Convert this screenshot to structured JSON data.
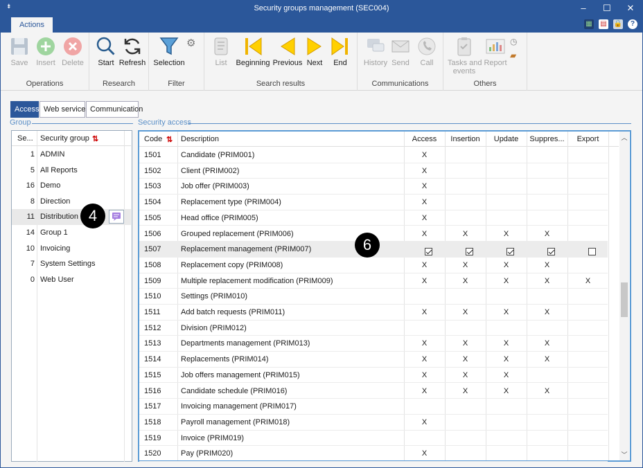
{
  "window": {
    "title": "Security groups management (SEC004)",
    "min": "–",
    "max": "☐",
    "close": "✕",
    "sysmenu": "⇟"
  },
  "ribbon": {
    "tab": "Actions",
    "groups": {
      "operations": "Operations",
      "research": "Research",
      "filter": "Filter",
      "search_results": "Search results",
      "communications": "Communications",
      "others": "Others"
    },
    "buttons": {
      "save": "Save",
      "insert": "Insert",
      "delete": "Delete",
      "start": "Start",
      "refresh": "Refresh",
      "selection": "Selection",
      "list": "List",
      "beginning": "Beginning",
      "previous": "Previous",
      "next": "Next",
      "end": "End",
      "history": "History",
      "send": "Send",
      "call": "Call",
      "tasks_l1": "Tasks and",
      "tasks_l2": "events",
      "report": "Report"
    }
  },
  "subtabs": [
    "Access",
    "Web services",
    "Communication"
  ],
  "section": {
    "group": "Group",
    "security_access": "Security access"
  },
  "group_table": {
    "headers": [
      "Se...",
      "Security group"
    ],
    "rows": [
      [
        "1",
        "ADMIN"
      ],
      [
        "5",
        "All Reports"
      ],
      [
        "16",
        "Demo"
      ],
      [
        "8",
        "Direction"
      ],
      [
        "11",
        "Distribution"
      ],
      [
        "14",
        "Group 1"
      ],
      [
        "10",
        "Invoicing"
      ],
      [
        "7",
        "System Settings"
      ],
      [
        "0",
        "Web User"
      ]
    ]
  },
  "access_table": {
    "headers": [
      "Code",
      "Description",
      "Access",
      "Insertion",
      "Update",
      "Suppres...",
      "Export"
    ],
    "rows": [
      {
        "code": "1501",
        "desc": "Candidate (PRIM001)",
        "a": "X",
        "i": "",
        "u": "",
        "s": "",
        "e": ""
      },
      {
        "code": "1502",
        "desc": "Client (PRIM002)",
        "a": "X",
        "i": "",
        "u": "",
        "s": "",
        "e": ""
      },
      {
        "code": "1503",
        "desc": "Job offer (PRIM003)",
        "a": "X",
        "i": "",
        "u": "",
        "s": "",
        "e": ""
      },
      {
        "code": "1504",
        "desc": "Replacement type (PRIM004)",
        "a": "X",
        "i": "",
        "u": "",
        "s": "",
        "e": ""
      },
      {
        "code": "1505",
        "desc": "Head office (PRIM005)",
        "a": "X",
        "i": "",
        "u": "",
        "s": "",
        "e": ""
      },
      {
        "code": "1506",
        "desc": "Grouped replacement (PRIM006)",
        "a": "X",
        "i": "X",
        "u": "X",
        "s": "X",
        "e": ""
      },
      {
        "code": "1507",
        "desc": "Replacement management (PRIM007)",
        "a": "cb1",
        "i": "cb1",
        "u": "cb1",
        "s": "cb1",
        "e": "cb0"
      },
      {
        "code": "1508",
        "desc": "Replacement copy (PRIM008)",
        "a": "X",
        "i": "X",
        "u": "X",
        "s": "X",
        "e": ""
      },
      {
        "code": "1509",
        "desc": "Multiple replacement modification (PRIM009)",
        "a": "X",
        "i": "X",
        "u": "X",
        "s": "X",
        "e": "X"
      },
      {
        "code": "1510",
        "desc": "Settings (PRIM010)",
        "a": "",
        "i": "",
        "u": "",
        "s": "",
        "e": ""
      },
      {
        "code": "1511",
        "desc": "Add batch requests (PRIM011)",
        "a": "X",
        "i": "X",
        "u": "X",
        "s": "X",
        "e": ""
      },
      {
        "code": "1512",
        "desc": "Division (PRIM012)",
        "a": "",
        "i": "",
        "u": "",
        "s": "",
        "e": ""
      },
      {
        "code": "1513",
        "desc": "Departments management (PRIM013)",
        "a": "X",
        "i": "X",
        "u": "X",
        "s": "X",
        "e": ""
      },
      {
        "code": "1514",
        "desc": "Replacements (PRIM014)",
        "a": "X",
        "i": "X",
        "u": "X",
        "s": "X",
        "e": ""
      },
      {
        "code": "1515",
        "desc": "Job offers management (PRIM015)",
        "a": "X",
        "i": "X",
        "u": "X",
        "s": "",
        "e": ""
      },
      {
        "code": "1516",
        "desc": "Candidate schedule (PRIM016)",
        "a": "X",
        "i": "X",
        "u": "X",
        "s": "X",
        "e": ""
      },
      {
        "code": "1517",
        "desc": "Invoicing management (PRIM017)",
        "a": "",
        "i": "",
        "u": "",
        "s": "",
        "e": ""
      },
      {
        "code": "1518",
        "desc": "Payroll management (PRIM018)",
        "a": "X",
        "i": "",
        "u": "",
        "s": "",
        "e": ""
      },
      {
        "code": "1519",
        "desc": "Invoice (PRIM019)",
        "a": "",
        "i": "",
        "u": "",
        "s": "",
        "e": ""
      },
      {
        "code": "1520",
        "desc": "Pay (PRIM020)",
        "a": "X",
        "i": "",
        "u": "",
        "s": "",
        "e": ""
      }
    ]
  },
  "badges": {
    "b4": "4",
    "b6": "6"
  },
  "colors": {
    "accent": "#2b579a",
    "badge": "#000000"
  }
}
